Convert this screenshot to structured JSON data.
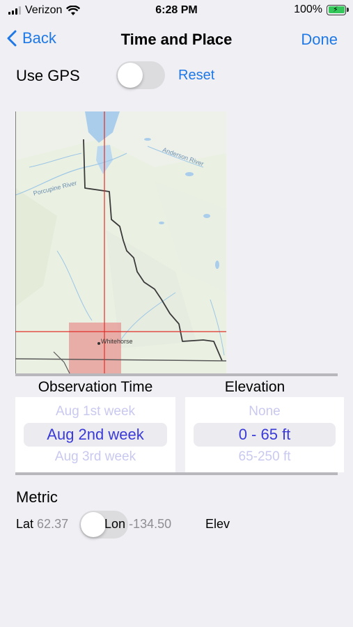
{
  "status_bar": {
    "carrier": "Verizon",
    "time": "6:28 PM",
    "battery_percent": "100%"
  },
  "nav": {
    "back_label": "Back",
    "title": "Time and Place",
    "done_label": "Done"
  },
  "gps": {
    "label": "Use GPS",
    "enabled": false,
    "reset_label": "Reset"
  },
  "map": {
    "labels": [
      "Porcupine River",
      "Anderson River",
      "Whitehorse"
    ]
  },
  "observation_time": {
    "title": "Observation Time",
    "prev": "Aug 1st week",
    "selected": "Aug 2nd week",
    "next": "Aug 3rd week"
  },
  "elevation": {
    "title": "Elevation",
    "prev": "None",
    "selected": "0 - 65 ft",
    "next": "65-250 ft"
  },
  "metric": {
    "label": "Metric",
    "enabled": false
  },
  "coords": {
    "lat_label": "Lat",
    "lat_value": "62.37",
    "lon_label": "Lon",
    "lon_value": "-134.50",
    "elev_label": "Elev"
  },
  "colors": {
    "accent": "#1e78e6",
    "picker_text": "#3a3ad8",
    "crosshair": "#e0302a",
    "selection_box": "#e88080"
  }
}
